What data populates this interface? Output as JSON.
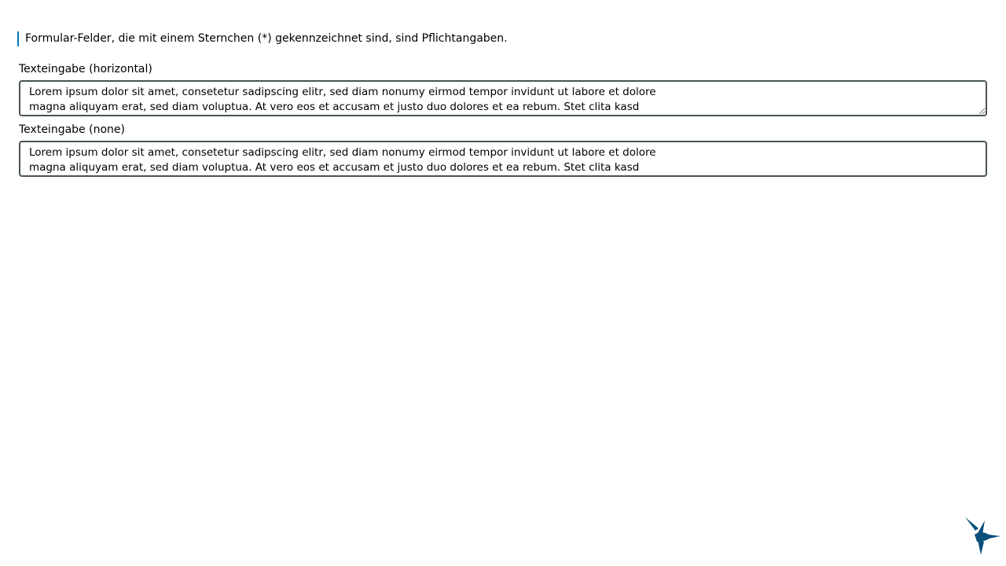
{
  "form": {
    "required_hint": "Formular-Felder, die mit einem Sternchen (*) gekennzeichnet sind, sind Pflichtangaben.",
    "fields": [
      {
        "label": "Texteingabe (horizontal)",
        "value": "Lorem ipsum dolor sit amet, consetetur sadipscing elitr, sed diam nonumy eirmod tempor invidunt ut labore et dolore\nmagna aliquyam erat, sed diam voluptua. At vero eos et accusam et justo duo dolores et ea rebum. Stet clita kasd",
        "resize": "horizontal"
      },
      {
        "label": "Texteingabe (none)",
        "value": "Lorem ipsum dolor sit amet, consetetur sadipscing elitr, sed diam nonumy eirmod tempor invidunt ut labore et dolore\nmagna aliquyam erat, sed diam voluptua. At vero eos et accusam et justo duo dolores et ea rebum. Stet clita kasd",
        "resize": "none"
      }
    ]
  },
  "logo": {
    "icon": "hummingbird-logo-icon",
    "color": "#0b4f7c"
  },
  "colors": {
    "accent": "#0077b6",
    "field_border": "#4a5455",
    "text": "#000000",
    "background": "#ffffff"
  }
}
